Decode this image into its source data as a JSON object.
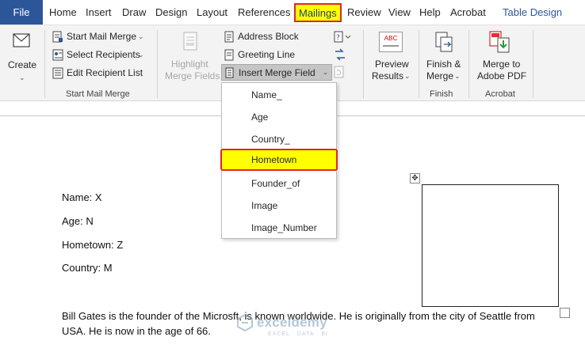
{
  "tabs": {
    "file": "File",
    "home": "Home",
    "insert": "Insert",
    "draw": "Draw",
    "design": "Design",
    "layout": "Layout",
    "references": "References",
    "mailings": "Mailings",
    "review": "Review",
    "view": "View",
    "help": "Help",
    "acrobat": "Acrobat",
    "table_design": "Table Design"
  },
  "ribbon": {
    "create": {
      "label": "Create",
      "icon": "envelope-icon"
    },
    "start_mail_merge_group": {
      "start_mail_merge": "Start Mail Merge",
      "select_recipients": "Select Recipients",
      "edit_recipient_list": "Edit Recipient List",
      "group_label": "Start Mail Merge"
    },
    "write_insert_group": {
      "highlight_line1": "Highlight",
      "highlight_line2": "Merge Fields",
      "address_block": "Address Block",
      "greeting_line": "Greeting Line",
      "insert_merge_field": "Insert Merge Field"
    },
    "preview_group": {
      "line1": "Preview",
      "line2": "Results",
      "icon_text": "ABC"
    },
    "finish_group": {
      "line1": "Finish &",
      "line2": "Merge",
      "group_label": "Finish"
    },
    "acrobat_group": {
      "line1": "Merge to",
      "line2": "Adobe PDF",
      "group_label": "Acrobat"
    }
  },
  "dropdown": {
    "items": [
      "Name_",
      "Age",
      "Country_",
      "Hometown",
      "Founder_of",
      "Image",
      "Image_Number"
    ],
    "selected": "Hometown"
  },
  "document": {
    "name_line": "Name: X",
    "age_line": "Age: N",
    "hometown_line": "Hometown: Z",
    "country_line": "Country: M",
    "paragraph": "Bill Gates is the founder of the Microsft, is known worldwide. He is originally from the city of Seattle from USA. He is now in the age of 66."
  },
  "watermark": {
    "name": "exceldemy",
    "tagline": "EXCEL · DATA · BI"
  },
  "colors": {
    "file_tab": "#2b579a",
    "highlight": "#ffff00",
    "highlight_border": "#e0252a",
    "ribbon_bg": "#f3f3f3"
  }
}
